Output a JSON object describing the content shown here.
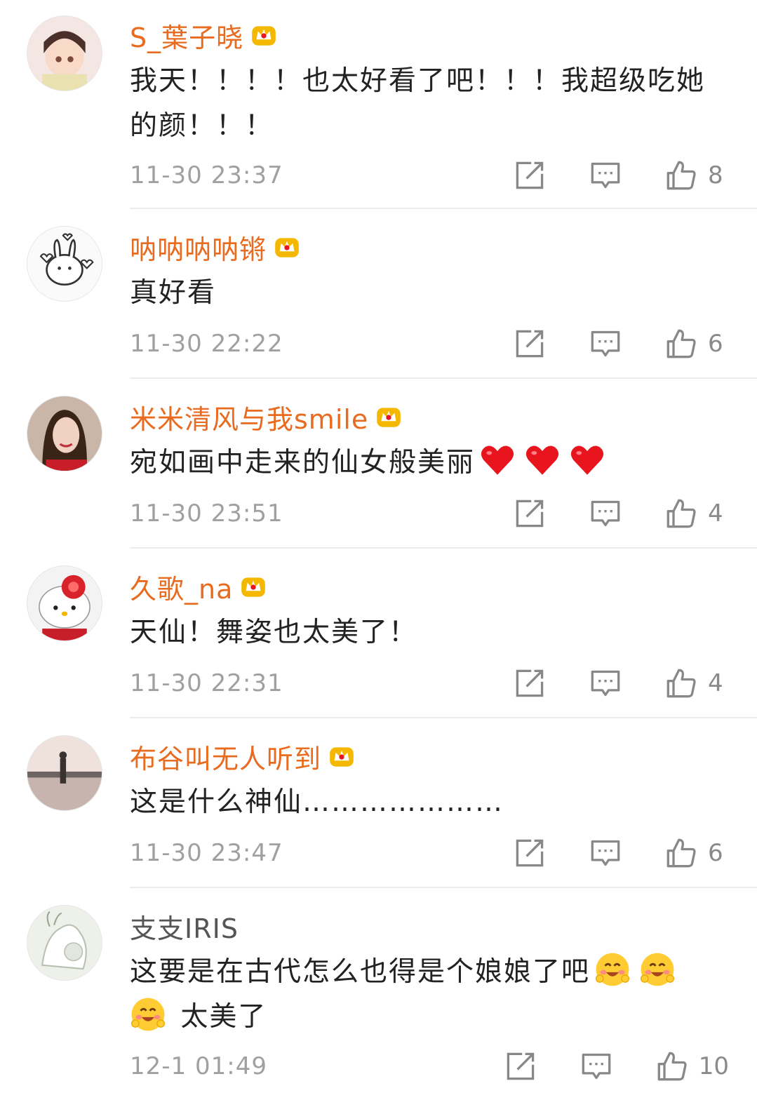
{
  "comments": [
    {
      "user": "S_葉子晓",
      "vip": true,
      "text": "我天！！！！也太好看了吧！！！我超级吃她的颜！！！",
      "time": "11-30 23:37",
      "likes": "8"
    },
    {
      "user": "呐呐呐呐锵",
      "vip": true,
      "text": "真好看",
      "time": "11-30 22:22",
      "likes": "6"
    },
    {
      "user": "米米清风与我smile",
      "vip": true,
      "text": "宛如画中走来的仙女般美丽",
      "time": "11-30 23:51",
      "likes": "4"
    },
    {
      "user": "久歌_na",
      "vip": true,
      "text": "天仙！舞姿也太美了！",
      "time": "11-30 22:31",
      "likes": "4"
    },
    {
      "user": "布谷叫无人听到",
      "vip": true,
      "text": "这是什么神仙…………………",
      "time": "11-30 23:47",
      "likes": "6"
    },
    {
      "user": "支支IRIS",
      "vip": false,
      "text": "这要是在古代怎么也得是个娘娘了吧",
      "text2": "太美了",
      "time": "12-1 01:49",
      "likes": "10"
    }
  ],
  "icons": {
    "repost": "repost-icon",
    "reply": "comment-icon",
    "like": "thumbs-up-icon",
    "vip": "crown-badge-icon",
    "heart": "red-heart-emoji",
    "smile": "blush-emoji"
  },
  "colors": {
    "username": "#e86b1f",
    "crown": "#f5b800",
    "heart": "#e8141e"
  }
}
